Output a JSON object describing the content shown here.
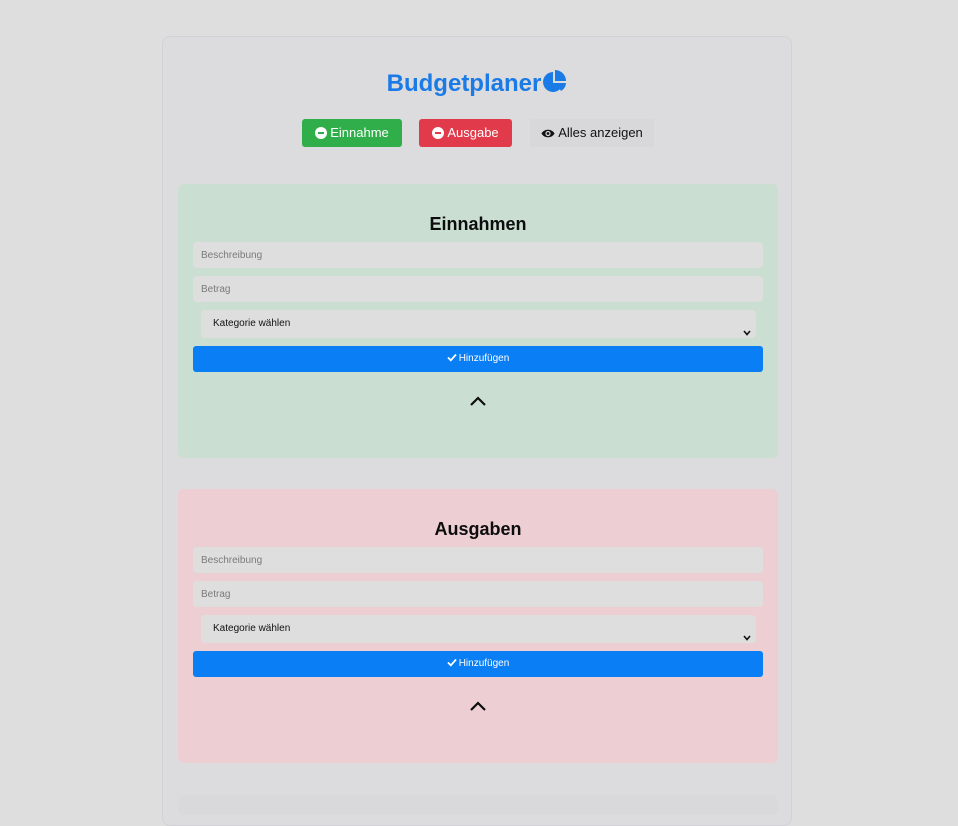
{
  "header": {
    "title": "Budgetplaner",
    "title_icon": "chart-pie-icon",
    "accent_color": "#1a7ae6"
  },
  "toolbar": {
    "income_label": "Einnahme",
    "expense_label": "Ausgabe",
    "show_all_label": "Alles anzeigen",
    "income_color": "#2fae4a",
    "expense_color": "#e13a4a"
  },
  "income": {
    "title": "Einnahmen",
    "description_placeholder": "Beschreibung",
    "amount_placeholder": "Betrag",
    "category_selected": "Kategorie wählen",
    "add_label": "Hinzufügen",
    "background": "#cadfd2"
  },
  "expense": {
    "title": "Ausgaben",
    "description_placeholder": "Beschreibung",
    "amount_placeholder": "Betrag",
    "category_selected": "Kategorie wählen",
    "add_label": "Hinzufügen",
    "background": "#edcfd3"
  },
  "add_button_color": "#0a7ef5"
}
